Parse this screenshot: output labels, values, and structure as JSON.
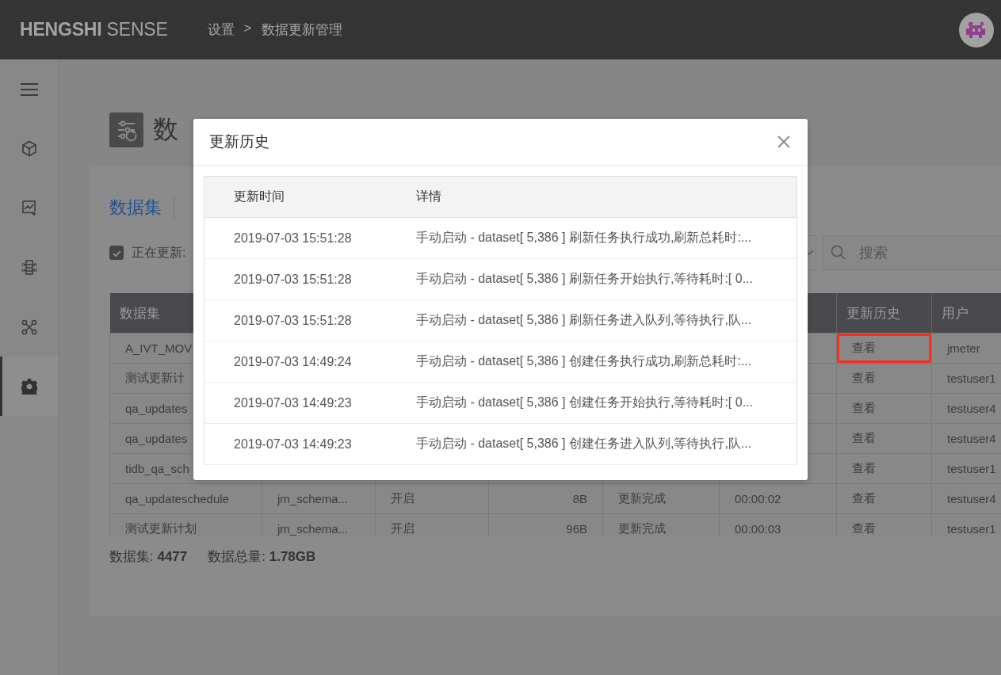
{
  "header": {
    "logo": "**HENGSHI** SENSE",
    "breadcrumb": [
      "设置",
      "数据更新管理"
    ],
    "separator": ">"
  },
  "sidebar": {
    "items": [
      {
        "kind": "menu",
        "selected": false
      },
      {
        "kind": "cube",
        "selected": false
      },
      {
        "kind": "chart",
        "selected": false
      },
      {
        "kind": "circuit",
        "selected": false
      },
      {
        "kind": "nodes",
        "selected": false
      },
      {
        "kind": "gear",
        "selected": true
      }
    ]
  },
  "page": {
    "title": "数"
  },
  "tabs": [
    {
      "label": "数据集",
      "selected": true
    }
  ],
  "filter": {
    "label": "正在更新:",
    "checked": true
  },
  "search": {
    "placeholder": "搜索"
  },
  "table": {
    "headers": {
      "dataset": "数据集",
      "history": "更新历史",
      "user": "用户"
    },
    "rows": [
      {
        "dataset": "A_IVT_MOV",
        "history": "查看",
        "highlighted": true,
        "user": "jmeter"
      },
      {
        "dataset": "测试更新计",
        "history": "查看",
        "highlighted": false,
        "user": "testuser1"
      },
      {
        "dataset": "qa_updates",
        "history": "查看",
        "highlighted": false,
        "user": "testuser4"
      },
      {
        "dataset": "qa_updates",
        "history": "查看",
        "highlighted": false,
        "user": "testuser4"
      },
      {
        "dataset": "tidb_qa_sch",
        "history": "查看",
        "highlighted": false,
        "user": "testuser1"
      },
      {
        "dataset": "qa_updateschedule",
        "column_2": "jm_schema...",
        "column_3": "开启",
        "column_4": "8B",
        "column_5": "更新完成",
        "column_6": "00:00:02",
        "history": "查看",
        "highlighted": false,
        "user": "testuser4"
      },
      {
        "dataset": "测试更新计划",
        "column_2": "jm_schema...",
        "column_3": "开启",
        "column_4": "96B",
        "column_5": "更新完成",
        "column_6": "00:00:03",
        "history": "查看",
        "highlighted": false,
        "user": "testuser1"
      }
    ]
  },
  "summary": [
    "数据集: **4477**",
    "数据总量: **1.78GB**"
  ],
  "dialog": {
    "title": "更新历史",
    "columns": [
      "更新时间",
      "详情"
    ],
    "rows": [
      {
        "time": "2019-07-03 15:51:28",
        "detail": "手动启动 - dataset[ 5,386 ] 刷新任务执行成功,刷新总耗时:..."
      },
      {
        "time": "2019-07-03 15:51:28",
        "detail": "手动启动 - dataset[ 5,386 ] 刷新任务开始执行,等待耗时:[ 0..."
      },
      {
        "time": "2019-07-03 15:51:28",
        "detail": "手动启动 - dataset[ 5,386 ] 刷新任务进入队列,等待执行,队..."
      },
      {
        "time": "2019-07-03 14:49:24",
        "detail": "手动启动 - dataset[ 5,386 ] 创建任务执行成功,刷新总耗时:..."
      },
      {
        "time": "2019-07-03 14:49:23",
        "detail": "手动启动 - dataset[ 5,386 ] 创建任务开始执行,等待耗时:[ 0..."
      },
      {
        "time": "2019-07-03 14:49:23",
        "detail": "手动启动 - dataset[ 5,386 ] 创建任务进入队列,等待执行,队..."
      }
    ]
  }
}
